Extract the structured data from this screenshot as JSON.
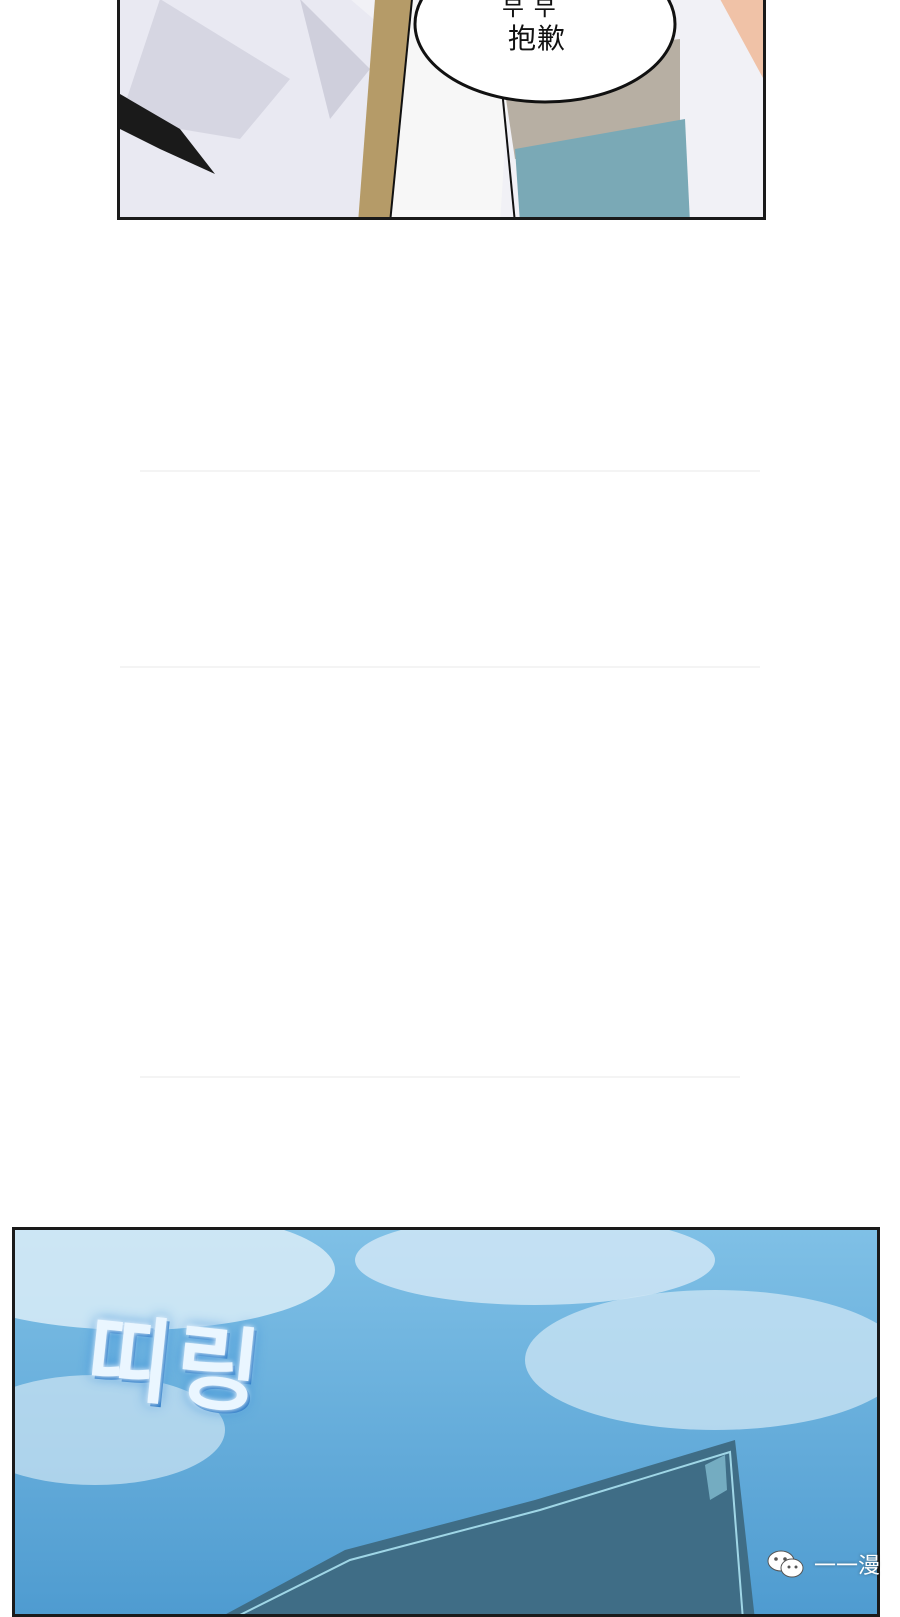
{
  "top_panel": {
    "speech_top_partial": "부 부",
    "speech_text": "抱歉"
  },
  "bottom_panel": {
    "sfx_text": "띠링"
  },
  "watermark": {
    "text": "一一漫",
    "icon": "wechat-icon"
  },
  "colors": {
    "sky": "#6fb4df",
    "panel_border": "#1a1a1a",
    "jeans": "#7aa9b6",
    "window_frame": "#3f6d86"
  }
}
